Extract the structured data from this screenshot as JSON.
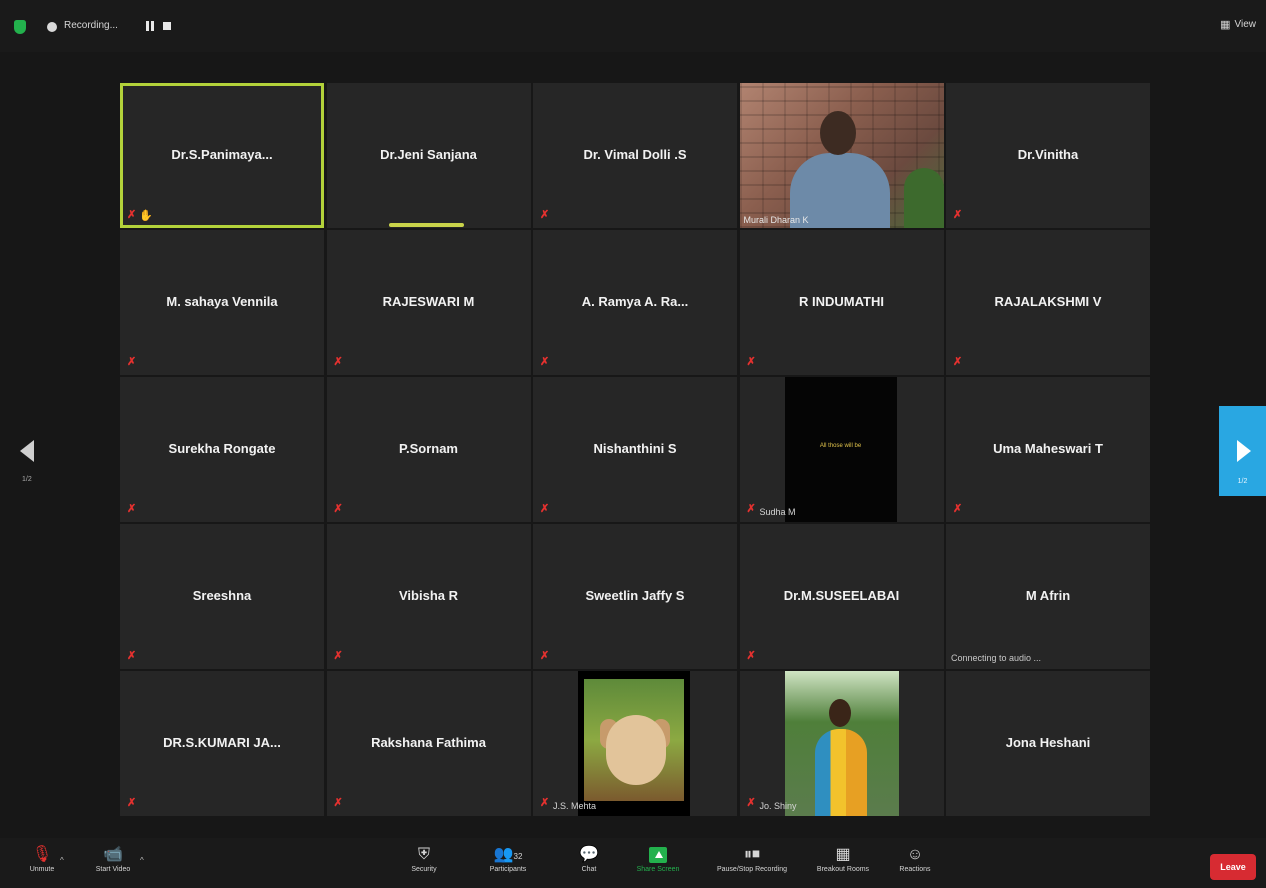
{
  "topbar": {
    "recording_label": "Recording...",
    "view_label": "View"
  },
  "navigation": {
    "left_page": "1/2",
    "right_page": "1/2"
  },
  "tiles": [
    {
      "name": "Dr.S.Panimaya...",
      "muted": true
    },
    {
      "name": "Dr.Jeni Sanjana",
      "muted": false
    },
    {
      "name": "Dr. Vimal Dolli .S",
      "muted": true
    },
    {
      "name": "Murali Dharan K",
      "video": true
    },
    {
      "name": "Dr.Vinitha",
      "muted": true
    },
    {
      "name": "M. sahaya Vennila",
      "muted": true
    },
    {
      "name": "RAJESWARI M",
      "muted": true
    },
    {
      "name": "A. Ramya A. Ra...",
      "muted": true
    },
    {
      "name": "R INDUMATHI",
      "muted": true
    },
    {
      "name": "RAJALAKSHMI V",
      "muted": true
    },
    {
      "name": "Surekha Rongate",
      "muted": true
    },
    {
      "name": "P.Sornam",
      "muted": true
    },
    {
      "name": "Nishanthini S",
      "muted": true
    },
    {
      "name": "Sudha M",
      "video": true,
      "video_text": "All those will be"
    },
    {
      "name": "Uma Maheswari T",
      "muted": true
    },
    {
      "name": "Sreeshna",
      "muted": true
    },
    {
      "name": "Vibisha R",
      "muted": true
    },
    {
      "name": "Sweetlin Jaffy S",
      "muted": true
    },
    {
      "name": "Dr.M.SUSEELABAI",
      "muted": true
    },
    {
      "name": "M Afrin",
      "status": "Connecting to audio ..."
    },
    {
      "name": "DR.S.KUMARI JA...",
      "muted": true
    },
    {
      "name": "Rakshana Fathima",
      "muted": true
    },
    {
      "name": "J.S. Mehta",
      "video": true
    },
    {
      "name": "Jo. Shiny",
      "video": true
    },
    {
      "name": "Jona Heshani",
      "muted": false
    }
  ],
  "toolbar": {
    "unmute": "Unmute",
    "start_video": "Start Video",
    "security": "Security",
    "participants": "Participants",
    "participants_count": "32",
    "chat": "Chat",
    "share_screen": "Share Screen",
    "pause_recording": "Pause/Stop Recording",
    "breakout_rooms": "Breakout Rooms",
    "reactions": "Reactions",
    "leave": "Leave"
  },
  "colors": {
    "active_border": "#b3d23a",
    "muted_icon": "#e5312f",
    "share_green": "#23b14d",
    "leave_red": "#d72b32",
    "nav_blue": "#29a7e2"
  }
}
